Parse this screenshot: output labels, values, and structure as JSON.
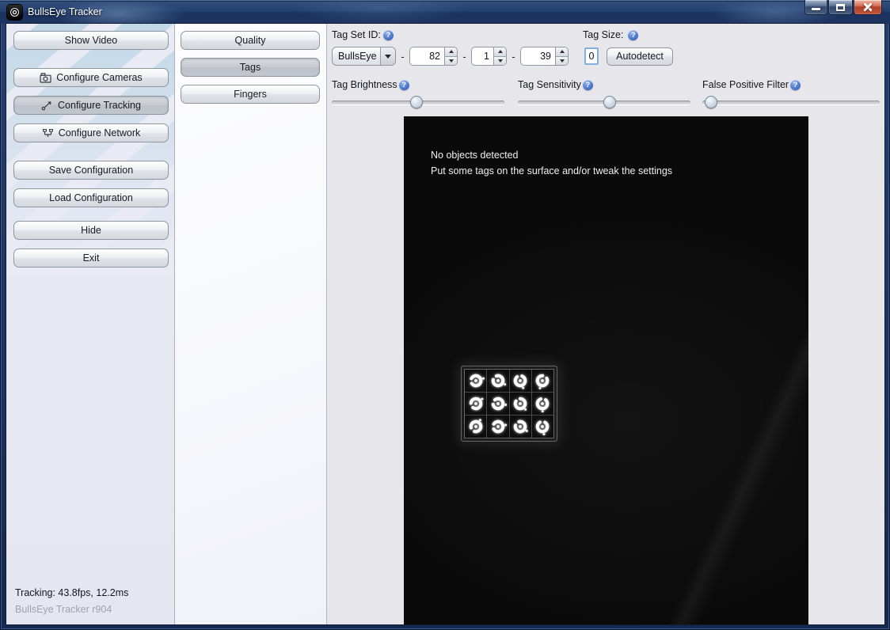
{
  "window": {
    "title": "BullsEye Tracker",
    "controls": [
      {
        "id": "minimize",
        "icon": "minimize-icon"
      },
      {
        "id": "maximize",
        "icon": "maximize-icon"
      },
      {
        "id": "close",
        "icon": "close-icon"
      }
    ]
  },
  "icons": {
    "help_glyph": "?"
  },
  "colors": {
    "titlebar_navy": "#24406e",
    "close_red": "#b03e28",
    "help_blue": "#3c68c4",
    "focus_blue": "#84aedd",
    "selected_button_gray": "#c8ccd2"
  },
  "sidebar": {
    "buttons": [
      {
        "id": "show-video",
        "label": "Show Video",
        "icon": null,
        "selected": false
      },
      {
        "id": "configure-cameras",
        "label": "Configure Cameras",
        "icon": "camera-icon",
        "selected": false
      },
      {
        "id": "configure-tracking",
        "label": "Configure Tracking",
        "icon": "tracking-icon",
        "selected": true
      },
      {
        "id": "configure-network",
        "label": "Configure Network",
        "icon": "network-icon",
        "selected": false
      },
      {
        "id": "save-configuration",
        "label": "Save Configuration",
        "icon": null,
        "selected": false
      },
      {
        "id": "load-configuration",
        "label": "Load Configuration",
        "icon": null,
        "selected": false
      },
      {
        "id": "hide",
        "label": "Hide",
        "icon": null,
        "selected": false
      },
      {
        "id": "exit",
        "label": "Exit",
        "icon": null,
        "selected": false
      }
    ],
    "status_line1": "Tracking: 43.8fps, 12.2ms",
    "status_line2": "BullsEye Tracker r904"
  },
  "tabs": [
    {
      "id": "quality",
      "label": "Quality",
      "selected": false
    },
    {
      "id": "tags",
      "label": "Tags",
      "selected": true
    },
    {
      "id": "fingers",
      "label": "Fingers",
      "selected": false
    }
  ],
  "tag_settings": {
    "tag_set_id_label": "Tag Set ID:",
    "dropdown_value": "BullsEye",
    "separator": "-",
    "id_parts": [
      "82",
      "1",
      "39"
    ],
    "tag_size_label": "Tag Size:",
    "tag_size_value": "0",
    "autodetect_label": "Autodetect",
    "sliders": [
      {
        "id": "tag-brightness",
        "label": "Tag Brightness",
        "value_pct": 49
      },
      {
        "id": "tag-sensitivity",
        "label": "Tag Sensitivity",
        "value_pct": 53
      },
      {
        "id": "false-positive-filter",
        "label": "False Positive Filter",
        "value_pct": 5
      }
    ]
  },
  "video": {
    "message_line1": "No objects detected",
    "message_line2": "Put some tags on the surface and/or tweak the settings",
    "tag_sheet": {
      "rows": 3,
      "cols": 4,
      "rotations": [
        205,
        250,
        290,
        330,
        185,
        230,
        270,
        310,
        165,
        210,
        255,
        300
      ]
    }
  }
}
